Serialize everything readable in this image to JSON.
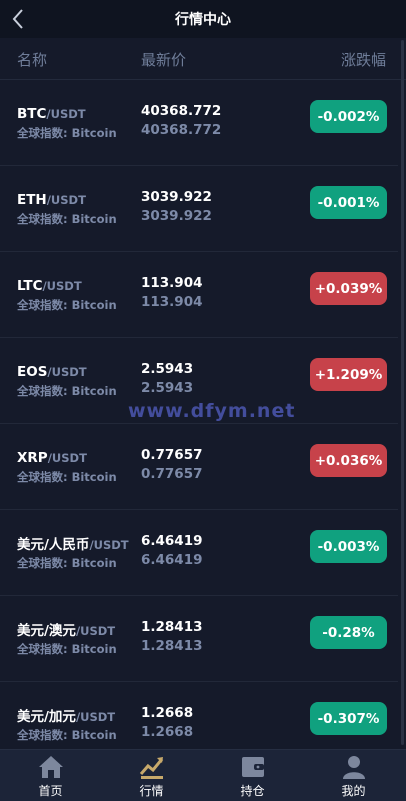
{
  "header": {
    "title": "行情中心",
    "back_icon": "chevron-left-icon"
  },
  "columns": {
    "name": "名称",
    "price": "最新价",
    "change": "涨跌幅"
  },
  "colors": {
    "up": "#c7424a",
    "down": "#10a17f",
    "background": "#151a2a"
  },
  "rows": [
    {
      "base": "BTC",
      "quote": "/USDT",
      "index": "全球指数: Bitcoin",
      "price": "40368.772",
      "price2": "40368.772",
      "change": "-0.002%",
      "dir": "down"
    },
    {
      "base": "ETH",
      "quote": "/USDT",
      "index": "全球指数: Bitcoin",
      "price": "3039.922",
      "price2": "3039.922",
      "change": "-0.001%",
      "dir": "down"
    },
    {
      "base": "LTC",
      "quote": "/USDT",
      "index": "全球指数: Bitcoin",
      "price": "113.904",
      "price2": "113.904",
      "change": "+0.039%",
      "dir": "up"
    },
    {
      "base": "EOS",
      "quote": "/USDT",
      "index": "全球指数: Bitcoin",
      "price": "2.5943",
      "price2": "2.5943",
      "change": "+1.209%",
      "dir": "up"
    },
    {
      "base": "XRP",
      "quote": "/USDT",
      "index": "全球指数: Bitcoin",
      "price": "0.77657",
      "price2": "0.77657",
      "change": "+0.036%",
      "dir": "up"
    },
    {
      "base": "美元/人民币",
      "quote": "/USDT",
      "index": "全球指数: Bitcoin",
      "price": "6.46419",
      "price2": "6.46419",
      "change": "-0.003%",
      "dir": "down"
    },
    {
      "base": "美元/澳元",
      "quote": "/USDT",
      "index": "全球指数: Bitcoin",
      "price": "1.28413",
      "price2": "1.28413",
      "change": "-0.28%",
      "dir": "down"
    },
    {
      "base": "美元/加元",
      "quote": "/USDT",
      "index": "全球指数: Bitcoin",
      "price": "1.2668",
      "price2": "1.2668",
      "change": "-0.307%",
      "dir": "down"
    }
  ],
  "watermark": "www.dfym.net",
  "tabbar": {
    "active": "行情",
    "items": [
      {
        "label": "首页",
        "icon": "home-icon"
      },
      {
        "label": "行情",
        "icon": "chart-icon"
      },
      {
        "label": "持仓",
        "icon": "wallet-icon"
      },
      {
        "label": "我的",
        "icon": "user-icon"
      }
    ]
  }
}
